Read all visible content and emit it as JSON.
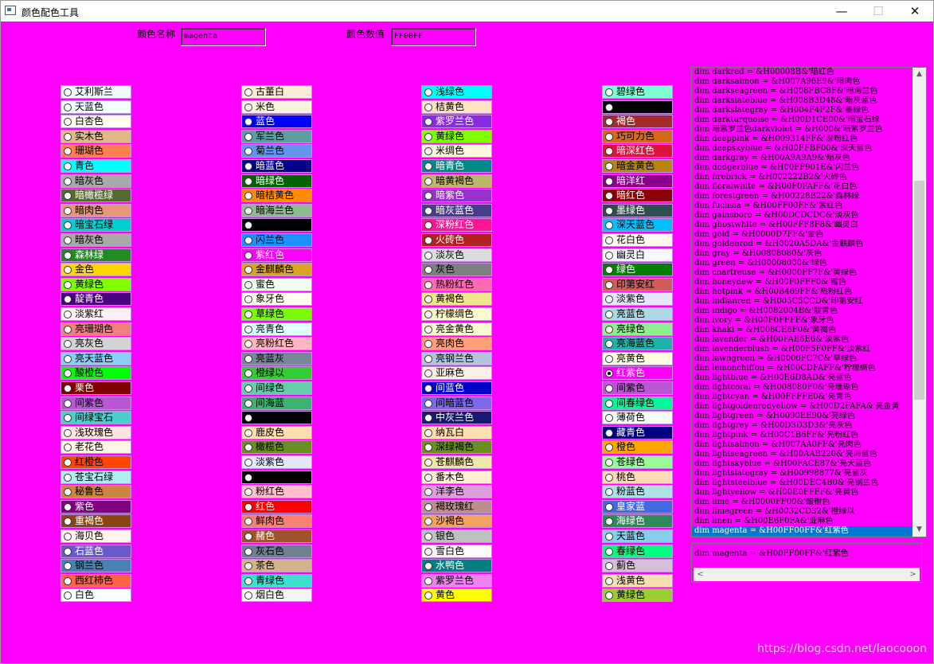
{
  "window": {
    "title": "颜色配色工具",
    "minimize": "—",
    "maximize": "☐",
    "close": "✕",
    "background": "#ff00ff"
  },
  "form": {
    "name_label": "颜色名称",
    "name_value": "magenta",
    "value_label": "颜色数值",
    "hex_value": "FF00FF"
  },
  "columns": [
    [
      {
        "label": "艾利斯兰",
        "color": "#f0f8ff"
      },
      {
        "label": "天蓝色",
        "color": "#f0ffff"
      },
      {
        "label": "白杏色",
        "color": "#fffff0"
      },
      {
        "label": "实木色",
        "color": "#deb887"
      },
      {
        "label": "珊瑚色",
        "color": "#ff7f50"
      },
      {
        "label": "青色",
        "color": "#00ffff"
      },
      {
        "label": "暗灰色",
        "color": "#a9a9a9"
      },
      {
        "label": "暗橄榄绿",
        "color": "#556b2f"
      },
      {
        "label": "暗肉色",
        "color": "#e9967a"
      },
      {
        "label": "暗宝石绿",
        "color": "#00ced1"
      },
      {
        "label": "暗灰色",
        "color": "#a9a9a9"
      },
      {
        "label": "森林绿",
        "color": "#228b22"
      },
      {
        "label": "金色",
        "color": "#ffd700"
      },
      {
        "label": "黄绿色",
        "color": "#7fff00"
      },
      {
        "label": "靛青色",
        "color": "#4b0082"
      },
      {
        "label": "淡紫红",
        "color": "#fff0f5"
      },
      {
        "label": "亮珊瑚色",
        "color": "#f08080"
      },
      {
        "label": "亮灰色",
        "color": "#d3d3d3"
      },
      {
        "label": "亮天蓝色",
        "color": "#87cefa"
      },
      {
        "label": "酸橙色",
        "color": "#00ff00"
      },
      {
        "label": "栗色",
        "color": "#800000"
      },
      {
        "label": "间紫色",
        "color": "#ba55d3"
      },
      {
        "label": "间绿宝石",
        "color": "#48d1cc"
      },
      {
        "label": "浅玫瑰色",
        "color": "#ffe4e1"
      },
      {
        "label": "老花色",
        "color": "#fdf5e6"
      },
      {
        "label": "红橙色",
        "color": "#ff4500"
      },
      {
        "label": "苍宝石绿",
        "color": "#afeeee"
      },
      {
        "label": "秘鲁色",
        "color": "#cd853f"
      },
      {
        "label": "紫色",
        "color": "#800080"
      },
      {
        "label": "重褐色",
        "color": "#8b4513"
      },
      {
        "label": "海贝色",
        "color": "#fff5ee"
      },
      {
        "label": "石蓝色",
        "color": "#6a5acd"
      },
      {
        "label": "钢兰色",
        "color": "#4682b4"
      },
      {
        "label": "西红柿色",
        "color": "#ff6347"
      },
      {
        "label": "白色",
        "color": "#ffffff"
      }
    ],
    [
      {
        "label": "古董白",
        "color": "#faebd7"
      },
      {
        "label": "米色",
        "color": "#f5f5dc"
      },
      {
        "label": "蓝色",
        "color": "#0000ff"
      },
      {
        "label": "军兰色",
        "color": "#5f9ea0"
      },
      {
        "label": "菊兰色",
        "color": "#6495ed"
      },
      {
        "label": "暗蓝色",
        "color": "#00008b"
      },
      {
        "label": "暗绿色",
        "color": "#006400"
      },
      {
        "label": "暗桔黄色",
        "color": "#ff8c00"
      },
      {
        "label": "暗海兰色",
        "color": "#8fbc8f"
      },
      {
        "label": "",
        "color": "#000000"
      },
      {
        "label": "闪兰色",
        "color": "#1e90ff"
      },
      {
        "label": "紫红色",
        "color": "#ff00ff"
      },
      {
        "label": "金麒麟色",
        "color": "#daa520"
      },
      {
        "label": "蜜色",
        "color": "#f0fff0"
      },
      {
        "label": "象牙色",
        "color": "#fffff0"
      },
      {
        "label": "草绿色",
        "color": "#7cfc00"
      },
      {
        "label": "亮青色",
        "color": "#e0ffff"
      },
      {
        "label": "亮粉红色",
        "color": "#ffb6c1"
      },
      {
        "label": "亮蓝灰",
        "color": "#778899"
      },
      {
        "label": "橙绿以",
        "color": "#32cd32"
      },
      {
        "label": "间绿色",
        "color": "#66cdaa"
      },
      {
        "label": "间海蓝",
        "color": "#3cb371"
      },
      {
        "label": "",
        "color": "#000000"
      },
      {
        "label": "鹿皮色",
        "color": "#ffdead"
      },
      {
        "label": "橄榄色",
        "color": "#6b8e23"
      },
      {
        "label": "淡紫色",
        "color": "#e6e6fa"
      },
      {
        "label": "",
        "color": "#000000"
      },
      {
        "label": "粉红色",
        "color": "#ffc0cb"
      },
      {
        "label": "红色",
        "color": "#ff0000"
      },
      {
        "label": "鲜肉色",
        "color": "#fa8072"
      },
      {
        "label": "赭色",
        "color": "#a0522d"
      },
      {
        "label": "灰石色",
        "color": "#708090"
      },
      {
        "label": "茶色",
        "color": "#d2b48c"
      },
      {
        "label": "青绿色",
        "color": "#40e0d0"
      },
      {
        "label": "烟白色",
        "color": "#f5f5f5"
      }
    ],
    [
      {
        "label": "浅绿色",
        "color": "#00ffff"
      },
      {
        "label": "桔黄色",
        "color": "#ffe4c4"
      },
      {
        "label": "紫罗兰色",
        "color": "#8a2be2"
      },
      {
        "label": "黄绿色",
        "color": "#7fff00"
      },
      {
        "label": "米绸色",
        "color": "#fff8dc"
      },
      {
        "label": "暗青色",
        "color": "#008b8b"
      },
      {
        "label": "暗黄褐色",
        "color": "#bdb76b"
      },
      {
        "label": "暗紫色",
        "color": "#9932cc"
      },
      {
        "label": "暗灰蓝色",
        "color": "#483d8b"
      },
      {
        "label": "深粉红色",
        "color": "#ff1493"
      },
      {
        "label": "火砖色",
        "color": "#b22222"
      },
      {
        "label": "淡灰色",
        "color": "#dcdcdc"
      },
      {
        "label": "灰色",
        "color": "#808080"
      },
      {
        "label": "热粉红色",
        "color": "#ff69b4"
      },
      {
        "label": "黄褐色",
        "color": "#f0e68c"
      },
      {
        "label": "柠檬绸色",
        "color": "#fffacd"
      },
      {
        "label": "亮金黄色",
        "color": "#fafad2"
      },
      {
        "label": "亮肉色",
        "color": "#ffa07a"
      },
      {
        "label": "亮钢兰色",
        "color": "#b0c4de"
      },
      {
        "label": "亚麻色",
        "color": "#faf0e6"
      },
      {
        "label": "间蓝色",
        "color": "#0000cd"
      },
      {
        "label": "间暗蓝色",
        "color": "#7b68ee"
      },
      {
        "label": "中灰兰色",
        "color": "#191970"
      },
      {
        "label": "纳瓦白",
        "color": "#ffdead"
      },
      {
        "label": "深绿褐色",
        "color": "#6b8e23"
      },
      {
        "label": "苍麒麟色",
        "color": "#eee8aa"
      },
      {
        "label": "番木色",
        "color": "#ffefd5"
      },
      {
        "label": "洋李色",
        "color": "#dda0dd"
      },
      {
        "label": "褐玫瑰红",
        "color": "#bc8f8f"
      },
      {
        "label": "沙褐色",
        "color": "#f4a460"
      },
      {
        "label": "银色",
        "color": "#c0c0c0"
      },
      {
        "label": "雪白色",
        "color": "#fffafa"
      },
      {
        "label": "水鸭色",
        "color": "#008080"
      },
      {
        "label": "紫罗兰色",
        "color": "#ee82ee"
      },
      {
        "label": "黄色",
        "color": "#ffff00"
      }
    ],
    [
      {
        "label": "碧绿色",
        "color": "#7fffd4"
      },
      {
        "label": "",
        "color": "#000000"
      },
      {
        "label": "褐色",
        "color": "#a52a2a"
      },
      {
        "label": "巧可力色",
        "color": "#d2691e"
      },
      {
        "label": "暗深红色",
        "color": "#dc143c"
      },
      {
        "label": "暗金黄色",
        "color": "#b8860b"
      },
      {
        "label": "暗洋红",
        "color": "#8b008b"
      },
      {
        "label": "暗红色",
        "color": "#8b0000"
      },
      {
        "label": "墨绿色",
        "color": "#2f4f4f"
      },
      {
        "label": "深天蓝色",
        "color": "#00bfff"
      },
      {
        "label": "花白色",
        "color": "#fffaf0"
      },
      {
        "label": "幽灵白",
        "color": "#f8f8ff"
      },
      {
        "label": "绿色",
        "color": "#008000"
      },
      {
        "label": "印第安红",
        "color": "#cd5c5c"
      },
      {
        "label": "淡紫色",
        "color": "#e6e6fa"
      },
      {
        "label": "亮蓝色",
        "color": "#add8e6"
      },
      {
        "label": "亮绿色",
        "color": "#90ee90"
      },
      {
        "label": "亮海蓝色",
        "color": "#20b2aa"
      },
      {
        "label": "亮黄色",
        "color": "#ffffe0"
      },
      {
        "label": "红紫色",
        "color": "#ff00ff"
      },
      {
        "label": "间紫色",
        "color": "#ba55d3"
      },
      {
        "label": "间春绿色",
        "color": "#00fa9a"
      },
      {
        "label": "薄荷色",
        "color": "#f5fffa"
      },
      {
        "label": "藏青色",
        "color": "#000080"
      },
      {
        "label": "橙色",
        "color": "#ffa500"
      },
      {
        "label": "苍绿色",
        "color": "#98fb98"
      },
      {
        "label": "桃色",
        "color": "#ffdab9"
      },
      {
        "label": "粉蓝色",
        "color": "#b0e0e6"
      },
      {
        "label": "皇家蓝",
        "color": "#4169e1"
      },
      {
        "label": "海绿色",
        "color": "#2e8b57"
      },
      {
        "label": "天蓝色",
        "color": "#87ceeb"
      },
      {
        "label": "春绿色",
        "color": "#00ff7f"
      },
      {
        "label": "蓟色",
        "color": "#d8bfd8"
      },
      {
        "label": "浅黄色",
        "color": "#f5deb3"
      },
      {
        "label": "黄绿色",
        "color": "#9acd32"
      }
    ]
  ],
  "selected": {
    "column": 3,
    "row": 19
  },
  "listbox": {
    "rows": [
      "dim darkred = &H00008B&'暗红色",
      "dim darksalmon = &H007A96E9&'暗肉色",
      "dim darkseagreen = &H008FBC8F&'暗海兰色",
      "dim darkslateblue = &H008B3D48&'暗灰蓝色",
      "dim darkslategray = &H004F4F2F&'墨绿色",
      "dim darkturquoise = &H00D1CE00&'暗宝石绿",
      "dim 暗紫罗兰色darkviolet = &H000&'暗紫罗兰色",
      "dim deeppink = &H009314FF&'深粉红色",
      "dim deepskyblue = &H00FFBF00&'深天蓝色",
      "dim darkgray = &H00A9A9A9&'暗灰色",
      "dim dodgerblue = &H00FF901E&'闪兰色",
      "dim firebrick = &H002222B2&'火砖色",
      "dim floralwhite = &H00F0FAFF&'花白色",
      "dim forestgreen = &H00228B22&'森林绿",
      "dim fuchsia = &H00FF00FF&'紫红色",
      "dim gainsboro = &H00DCDCDC&'淡灰色",
      "dim ghostwhite = &H00FFF8F8&'幽灵白",
      "dim gold = &H0000D7FF&'金色",
      "dim goldenrod = &H0020A5DA&'金麒麟色",
      "dim gray = &H00808080&'灰色",
      "dim green = &H00008000&'绿色",
      "dim chartreuse = &H0000FF7F&'黄绿色",
      "dim honeydew = &H00F0FFF0&'蜜色",
      "dim hotpink = &H00B469FF&'热粉红色",
      "dim indianred = &H005C5CCD&'印第安红",
      "dim indigo = &H0082004B&'靛青色",
      "dim ivory = &H00F0FFFF&'象牙色",
      "dim khaki = &H008CE6F0&'黄褐色",
      "dim lavender = &H00FAE6E6&'淡紫色",
      "dim lavenderblush = &H00F5F0FF&'淡紫红",
      "dim lawngreen = &H0000FC7C&'草绿色",
      "dim lemonchiffon = &H00CDFAFF&'柠檬绸色",
      "dim lightblue = &H00E6D8AD&'亮蓝色",
      "dim lightcoral = &H008080F0&'亮珊瑚色",
      "dim lightcyan = &H00FFFFE0&'亮青色",
      "dim lightgoldenrodyellow = &H00D2FAFA&'亮金黄",
      "dim lightgreen = &H0090EE90&'亮绿色",
      "dim lightgrey = &H00D3D3D3&'亮灰色",
      "dim lightpink = &H00C1B6FF&'亮粉红色",
      "dim lightsalmon = &H007AA0FF&'亮肉色",
      "dim lightseagreen = &H00AAB220&'亮海蓝色",
      "dim lightskyblue = &H00FACE87&'亮天蓝色",
      "dim lightslategray = &H00998877&'亮蓝灰",
      "dim lightsteelblue = &H00DEC4B0&'亮钢兰色",
      "dim lightyellow = &H00E0FFFF&'亮黄色",
      "dim lime = &H0000FF00&'酸橙色",
      "dim limegreen = &H0032CD32&'橙绿以",
      "dim linen = &H00E6F0FA&'亚麻色",
      "dim magenta = &H00FF00FF&'红紫色"
    ],
    "selected_index": 48,
    "scroll_up": "▲",
    "scroll_down": "▼"
  },
  "memo": {
    "text": "dim magenta = &H00FF00FF&'红紫色",
    "scroll_left": "<",
    "scroll_right": ">"
  },
  "watermark": "https://blog.csdn.net/laocooon"
}
